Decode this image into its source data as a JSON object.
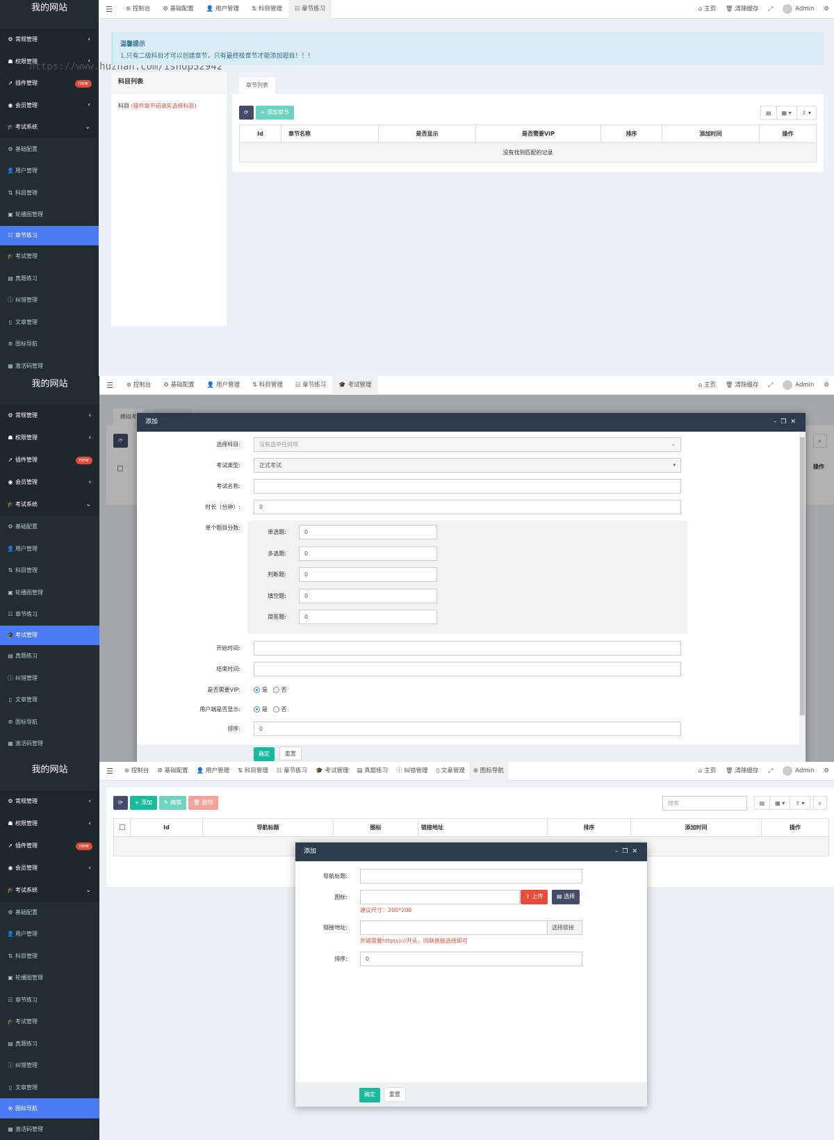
{
  "site_title": "我的网站",
  "watermark": "https://www.huzhan.com/ishop52942",
  "new_badge": "new",
  "menu": {
    "top": [
      "常规管理",
      "权限管理",
      "插件管理",
      "会员管理",
      "考试系统"
    ],
    "sub": [
      "基础配置",
      "用户管理",
      "科目管理",
      "轮播图管理",
      "章节练习",
      "考试管理",
      "真题练习",
      "纠错管理",
      "文章管理",
      "图标导航",
      "激活码管理"
    ]
  },
  "topbar": {
    "tabs1": [
      "控制台",
      "基础配置",
      "用户管理",
      "科目管理",
      "章节练习"
    ],
    "tabs2": [
      "控制台",
      "基础配置",
      "用户管理",
      "科目管理",
      "章节练习",
      "考试管理"
    ],
    "tabs3": [
      "控制台",
      "基础配置",
      "用户管理",
      "科目管理",
      "章节练习",
      "考试管理",
      "真题练习",
      "纠错管理",
      "文章管理",
      "图标导航"
    ],
    "home": "主页",
    "clear_cache": "清除缓存",
    "admin": "Admin"
  },
  "panel1": {
    "tip_title": "温馨提示",
    "tip_text": "1.只有二级科目才可以创建章节，只有最终极章节才能添加题目！！！",
    "subject_list_title": "科目列表",
    "subject_label": "科目",
    "subject_hint": "(操作章节前请先选择科目)",
    "tab_label": "章节列表",
    "add_button": "添加章节",
    "columns": [
      "Id",
      "章节名称",
      "是否显示",
      "是否需要VIP",
      "排序",
      "添加时间",
      "操作"
    ],
    "empty_text": "没有找到匹配的记录"
  },
  "panel2": {
    "bg_tab": "模拟考",
    "bg_col": "操作",
    "modal_title": "添加",
    "subject_label": "选择科目:",
    "subject_placeholder": "没有选中任何项",
    "type_label": "考试类型:",
    "type_value": "正式考试",
    "name_label": "考试名称:",
    "duration_label": "时长（分钟）:",
    "duration_value": "0",
    "score_label": "单个题目分数:",
    "scores": [
      {
        "label": "单选题:",
        "value": "0"
      },
      {
        "label": "多选题:",
        "value": "0"
      },
      {
        "label": "判断题:",
        "value": "0"
      },
      {
        "label": "填空题:",
        "value": "0"
      },
      {
        "label": "简答题:",
        "value": "0"
      }
    ],
    "start_label": "开始时间:",
    "end_label": "结束时间:",
    "vip_label": "是否需要VIP:",
    "show_label": "用户端是否显示:",
    "yes": "是",
    "no": "否",
    "sort_label": "排序:",
    "sort_value": "0",
    "confirm": "确定",
    "reset": "重置"
  },
  "panel3": {
    "add": "添加",
    "edit": "编辑",
    "delete": "删除",
    "search_placeholder": "搜索",
    "columns": [
      "Id",
      "导航标题",
      "图标",
      "链接地址",
      "排序",
      "添加时间",
      "操作"
    ],
    "modal_title": "添加",
    "nav_title_label": "导航标题:",
    "icon_label": "图标:",
    "upload": "上传",
    "choose": "选择",
    "icon_help": "建议尺寸：200*200",
    "link_label": "链接地址:",
    "choose_link": "选择链接",
    "link_help": "外链需要http(s)://开头，内联直接选择即可",
    "sort_label": "排序:",
    "sort_value": "0",
    "confirm": "确定",
    "reset": "重置"
  },
  "colors": {
    "sidebar": "#222d32",
    "active": "#4a7af4",
    "header": "#2c3b4d",
    "green": "#18bc9c",
    "red": "#e74c3c"
  }
}
